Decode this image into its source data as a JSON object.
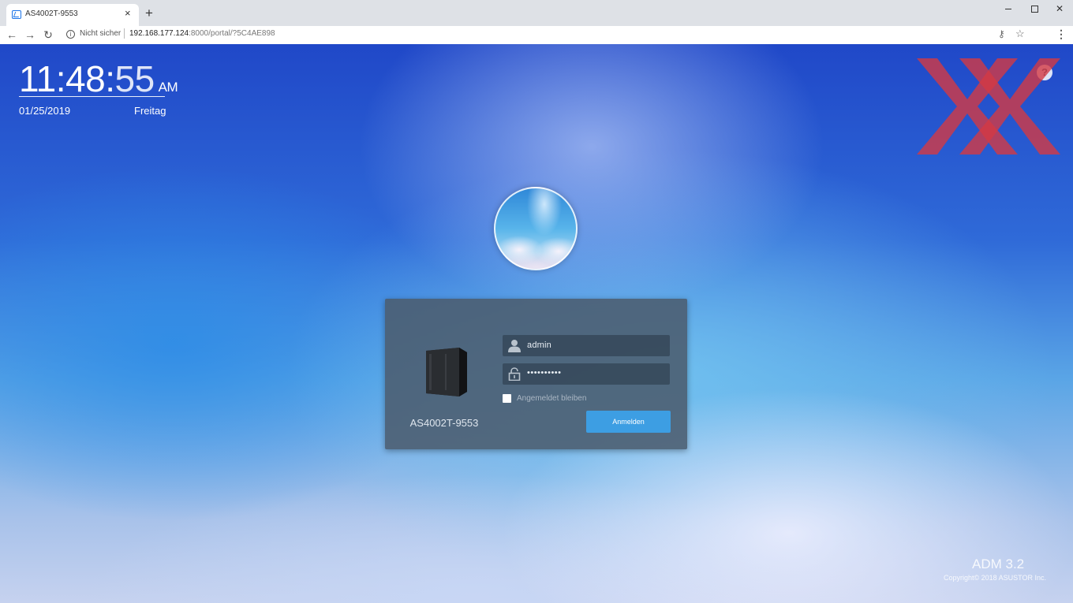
{
  "browser": {
    "tab_title": "AS4002T-9553",
    "tab_close": "×",
    "new_tab": "+",
    "security_label": "Nicht sicher",
    "url_host": "192.168.177.124",
    "url_path": ":8000/portal/?5C4AE898",
    "icons": [
      "back-arrow-icon",
      "forward-arrow-icon",
      "reload-icon",
      "info-icon",
      "key-icon",
      "star-icon",
      "menu-icon",
      "minimize-icon",
      "maximize-icon",
      "close-icon"
    ]
  },
  "clock": {
    "hours_minutes": "11:48:",
    "seconds": "55",
    "ampm": "AM",
    "date": "01/25/2019",
    "weekday": "Freitag"
  },
  "help": {
    "label": "?"
  },
  "login": {
    "device_name": "AS4002T-9553",
    "username": "admin",
    "password_mask": "••••••••••",
    "remember_label": "Angemeldet bleiben",
    "remember_checked": false,
    "submit_label": "Anmelden"
  },
  "footer": {
    "version": "ADM 3.2",
    "copyright": "Copyright© 2018 ASUSTOR Inc."
  },
  "colors": {
    "accent": "#3d9ee3",
    "panel": "#4b5c6e",
    "watermark": "#d33a44"
  }
}
